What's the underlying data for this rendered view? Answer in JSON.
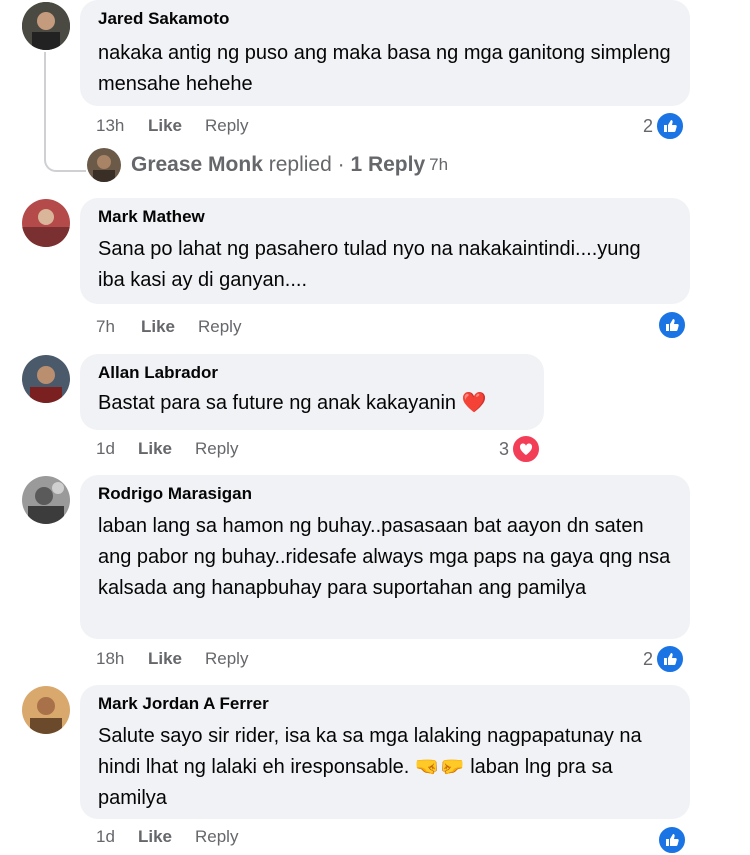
{
  "comments": [
    {
      "author": "Jared Sakamoto",
      "text": "nakaka antig ng puso ang maka basa ng mga ganitong simpleng mensahe hehehe",
      "time": "13h",
      "like": "Like",
      "reply": "Reply",
      "reaction_count": "2",
      "reactions": [
        "like"
      ]
    },
    {
      "author": "Mark Mathew",
      "text": "Sana po lahat ng pasahero tulad nyo na nakakaintindi....yung iba kasi ay di ganyan....",
      "time": "7h",
      "like": "Like",
      "reply": "Reply",
      "reaction_count": "",
      "reactions": [
        "like"
      ]
    },
    {
      "author": "Allan Labrador",
      "text": "Bastat para sa future ng anak kakayanin ❤️",
      "time": "1d",
      "like": "Like",
      "reply": "Reply",
      "reaction_count": "3",
      "reactions": [
        "love"
      ]
    },
    {
      "author": "Rodrigo Marasigan",
      "text": "laban lang sa hamon ng buhay..pasasaan bat aayon dn saten ang pabor ng buhay..ridesafe always mga paps na gaya qng nsa kalsada ang hanapbuhay para suportahan ang pamilya",
      "time": "18h",
      "like": "Like",
      "reply": "Reply",
      "reaction_count": "2",
      "reactions": [
        "like"
      ]
    },
    {
      "author": "Mark Jordan A Ferrer",
      "text": "Salute sayo sir rider, isa ka sa mga lalaking nagpapatunay na hindi lhat ng lalaki eh iresponsable. 🤜🤛 laban lng pra sa pamilya",
      "time": "1d",
      "like": "Like",
      "reply": "Reply",
      "reaction_count": "",
      "reactions": [
        "like"
      ]
    }
  ],
  "replied_row": {
    "name": "Grease Monk",
    "verb": " replied · ",
    "count": "1 Reply",
    "time": "7h"
  },
  "colors": {
    "bubble": "#f0f2f5",
    "meta": "#65676b",
    "like_blue": "#1b74e4",
    "love_red": "#f33e58"
  }
}
